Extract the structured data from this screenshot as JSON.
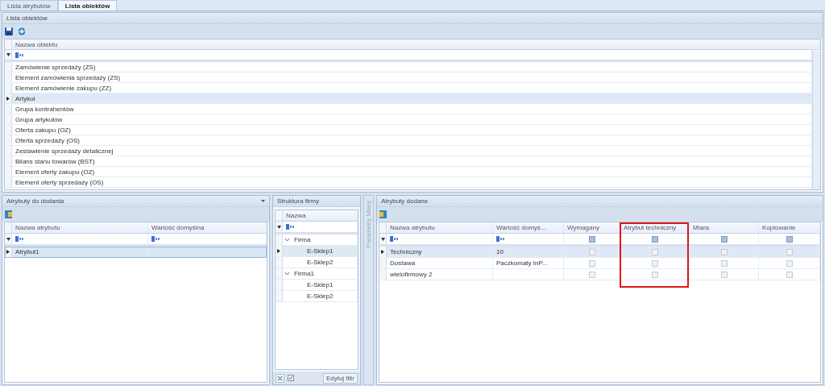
{
  "tabs": [
    {
      "label": "Lista atrybutów",
      "selected": false
    },
    {
      "label": "Lista obiektów",
      "selected": true
    }
  ],
  "objects_panel": {
    "title": "Lista obiektów",
    "column": "Nazwa obiektu",
    "rows": [
      {
        "name": "Zamówienie sprzedaży (ZS)",
        "selected": false
      },
      {
        "name": "Element zamówienia sprzedaży (ZS)",
        "selected": false
      },
      {
        "name": "Element zamówienie zakupu (ZZ)",
        "selected": false
      },
      {
        "name": "Artykuł",
        "selected": true
      },
      {
        "name": "Grupa kontrahentów",
        "selected": false
      },
      {
        "name": "Grupa artykułów",
        "selected": false
      },
      {
        "name": "Oferta zakupu (OZ)",
        "selected": false
      },
      {
        "name": "Oferta sprzedaży (OS)",
        "selected": false
      },
      {
        "name": "Zestawienie sprzedaży detalicznej",
        "selected": false
      },
      {
        "name": "Bilans stanu towarów (BST)",
        "selected": false
      },
      {
        "name": "Element oferty zakupu (OZ)",
        "selected": false
      },
      {
        "name": "Element oferty sprzedaży (OS)",
        "selected": false
      }
    ]
  },
  "available_panel": {
    "title": "Atrybuty do dodania",
    "columns": [
      "Nazwa atrybutu",
      "Wartość domyślna"
    ],
    "rows": [
      {
        "name": "Atrybut1",
        "selected": true
      }
    ]
  },
  "structure_panel": {
    "title": "Struktura firmy",
    "column": "Nazwa",
    "tree": [
      {
        "label": "Firma",
        "expanded": true,
        "children": [
          {
            "label": "E-Sklep1",
            "selected": true
          },
          {
            "label": "E-Sklep2",
            "selected": false
          }
        ]
      },
      {
        "label": "Firma1",
        "expanded": true,
        "children": [
          {
            "label": "E-Sklep1",
            "selected": false
          },
          {
            "label": "E-Sklep2",
            "selected": false
          }
        ]
      }
    ],
    "filter_checked": true,
    "filter_button": "Edytuj filtr"
  },
  "side_tab": "Parametry Miary",
  "added_panel": {
    "title": "Atrybuty dodane",
    "columns": [
      {
        "label": "Nazwa atrybutu",
        "highlighted": false
      },
      {
        "label": "Wartość domyś...",
        "highlighted": false
      },
      {
        "label": "Wymagany",
        "highlighted": false,
        "filter_indeterminate": true
      },
      {
        "label": "Atrybut techniczny",
        "highlighted": true,
        "filter_indeterminate": true
      },
      {
        "label": "Miara",
        "highlighted": false,
        "filter_indeterminate": true
      },
      {
        "label": "Kopiowanie",
        "highlighted": false,
        "filter_indeterminate": true
      }
    ],
    "rows": [
      {
        "name": "Techniczny",
        "value": "10",
        "required": false,
        "technical": false,
        "measure": false,
        "copying": false,
        "selected": true
      },
      {
        "name": "Dostawa",
        "value": "Paczkomaty InP...",
        "required": false,
        "technical": false,
        "measure": false,
        "copying": false,
        "selected": false
      },
      {
        "name": "wielofirmowy 2",
        "required": false,
        "technical": false,
        "measure": false,
        "copying": false,
        "selected": false
      }
    ]
  }
}
